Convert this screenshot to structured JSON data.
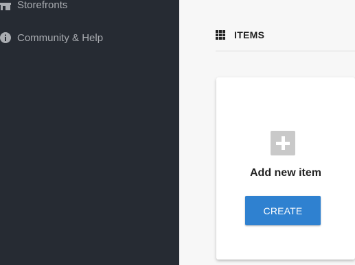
{
  "sidebar": {
    "items": [
      {
        "label": "Storefronts",
        "icon": "storefront-icon"
      },
      {
        "label": "Community & Help",
        "icon": "info-icon"
      }
    ]
  },
  "header": {
    "title": "ITEMS",
    "icon": "grid-icon"
  },
  "card": {
    "icon": "plus-icon",
    "label": "Add new item",
    "button_label": "CREATE"
  },
  "colors": {
    "sidebar_bg": "#262b33",
    "accent": "#2f81d0",
    "page_bg": "#f7f7f7"
  }
}
